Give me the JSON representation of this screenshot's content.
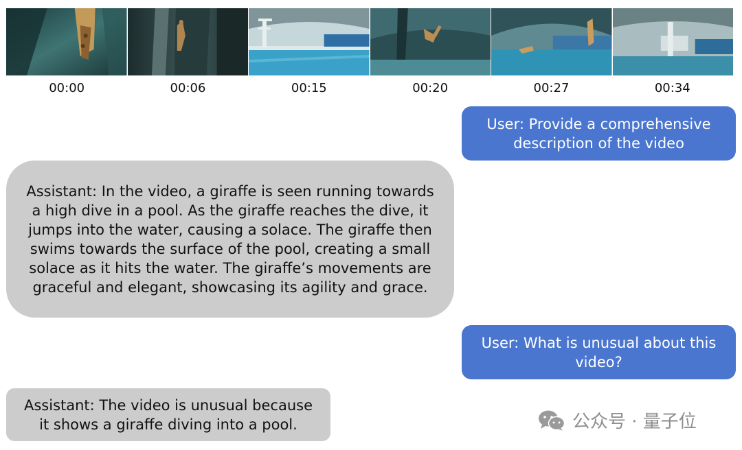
{
  "frames": [
    {
      "time": "00:00",
      "scene": "giraffe-on-high-dive"
    },
    {
      "time": "00:06",
      "scene": "giraffe-running-on-platform"
    },
    {
      "time": "00:15",
      "scene": "empty-pool-with-diving-tower"
    },
    {
      "time": "00:20",
      "scene": "giraffe-jumping"
    },
    {
      "time": "00:27",
      "scene": "giraffe-in-pool"
    },
    {
      "time": "00:34",
      "scene": "diving-tower-empty"
    }
  ],
  "chat": {
    "user1": "User: Provide a comprehensive description of the video",
    "assistant1": "Assistant: In the video, a giraffe is seen running towards a high dive in a pool. As the giraffe reaches the dive, it jumps into the water, causing a solace. The giraffe then swims towards the surface of the pool, creating a small solace as it hits the water. The giraffe’s movements are graceful and elegant, showcasing its agility and grace.",
    "user2": "User: What is unusual about this video?",
    "assistant2": "Assistant: The video is unusual because it shows a giraffe diving into a pool."
  },
  "watermark": {
    "text": "公众号 · 量子位",
    "icon": "wechat-icon"
  },
  "colors": {
    "user_bubble": "#4a76cf",
    "assistant_bubble": "#cccccc",
    "watermark": "#8e8e8e"
  }
}
